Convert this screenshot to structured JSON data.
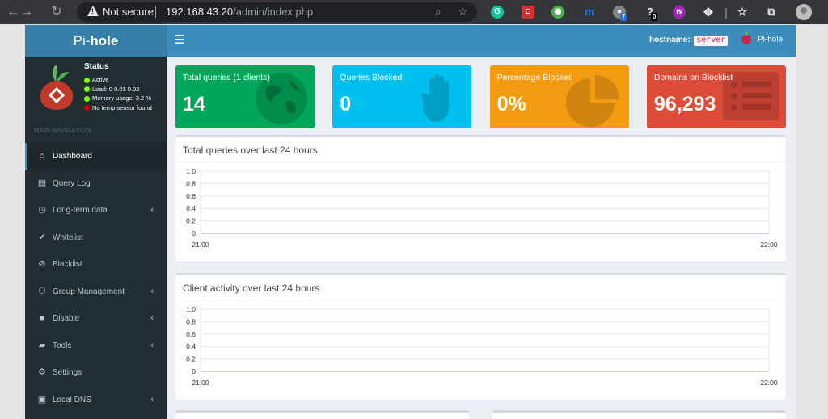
{
  "browser": {
    "security_label": "Not secure",
    "url_host": "192.168.43.20",
    "url_path": "/admin/index.php",
    "extension_badges": [
      "7",
      "0"
    ]
  },
  "app": {
    "logo_prefix": "Pi-",
    "logo_bold": "hole",
    "hostname_label": "hostname:",
    "hostname_value": "server",
    "user_label": "Pi-hole"
  },
  "sidebar": {
    "status_title": "Status",
    "status": [
      {
        "text": "Active",
        "dot": "green"
      },
      {
        "text": "Load:  0  0.01  0.02",
        "dot": "green"
      },
      {
        "text": "Memory usage:  3.2 %",
        "dot": "green"
      },
      {
        "text": "No temp sensor found",
        "dot": "red"
      }
    ],
    "nav_header": "MAIN NAVIGATION",
    "items": [
      {
        "label": "Dashboard",
        "icon": "home-icon",
        "glyph": "⌂",
        "active": true,
        "chevron": false
      },
      {
        "label": "Query Log",
        "icon": "file-icon",
        "glyph": "▤",
        "active": false,
        "chevron": false
      },
      {
        "label": "Long-term data",
        "icon": "clock-icon",
        "glyph": "◷",
        "active": false,
        "chevron": true
      },
      {
        "label": "Whitelist",
        "icon": "check-circle-icon",
        "glyph": "✔",
        "active": false,
        "chevron": false
      },
      {
        "label": "Blacklist",
        "icon": "ban-icon",
        "glyph": "⊘",
        "active": false,
        "chevron": false
      },
      {
        "label": "Group Management",
        "icon": "users-icon",
        "glyph": "⚇",
        "active": false,
        "chevron": true
      },
      {
        "label": "Disable",
        "icon": "stop-icon",
        "glyph": "■",
        "active": false,
        "chevron": true
      },
      {
        "label": "Tools",
        "icon": "folder-icon",
        "glyph": "▰",
        "active": false,
        "chevron": true
      },
      {
        "label": "Settings",
        "icon": "gears-icon",
        "glyph": "⚙",
        "active": false,
        "chevron": false
      },
      {
        "label": "Local DNS",
        "icon": "address-book-icon",
        "glyph": "▣",
        "active": false,
        "chevron": true
      }
    ]
  },
  "stats": [
    {
      "title": "Total queries (1 clients)",
      "value": "14",
      "icon": "globe-icon",
      "color": "#00a65a"
    },
    {
      "title": "Queries Blocked",
      "value": "0",
      "icon": "hand-icon",
      "color": "#00c0ef"
    },
    {
      "title": "Percentage Blocked",
      "value": "0%",
      "icon": "pie-chart-icon",
      "color": "#f39c12"
    },
    {
      "title": "Domains on Blocklist",
      "value": "96,293",
      "icon": "list-icon",
      "color": "#dd4b39"
    }
  ],
  "chart_data": [
    {
      "type": "area",
      "title": "Total queries over last 24 hours",
      "x": [
        "21:00",
        "22:00"
      ],
      "y_ticks": [
        "0",
        "0.2",
        "0.4",
        "0.6",
        "0.8",
        "1.0"
      ],
      "ylim": [
        0,
        1
      ],
      "series": [
        {
          "values": [
            0,
            0
          ]
        }
      ],
      "grid": true
    },
    {
      "type": "area",
      "title": "Client activity over last 24 hours",
      "x": [
        "21:00",
        "22:00"
      ],
      "y_ticks": [
        "0",
        "0.2",
        "0.4",
        "0.6",
        "0.8",
        "1.0"
      ],
      "ylim": [
        0,
        1
      ],
      "series": [
        {
          "values": [
            0,
            0
          ]
        }
      ],
      "grid": true
    }
  ]
}
